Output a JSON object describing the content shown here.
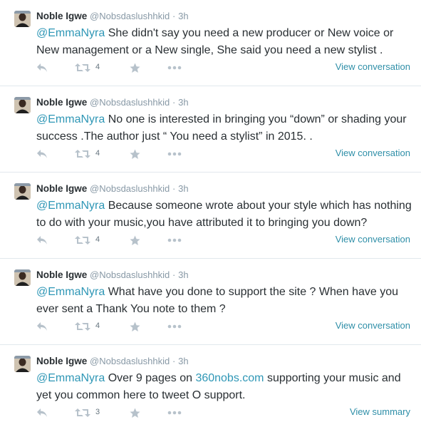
{
  "colors": {
    "mention": "#2f97b6",
    "muted": "#8899a6",
    "action_icon": "#b7c2cb",
    "divider": "#e1e8ed"
  },
  "tweets": [
    {
      "name": "Noble Igwe",
      "handle": "@Nobsdaslushhkid",
      "sep": "·",
      "time": "3h",
      "mention": "@EmmaNyra",
      "text": " She didn't say you need a new producer or New voice or New management or a New single, She said you need a new stylist .",
      "link": "",
      "text_after": "",
      "retweets": "4",
      "footer_link": "View conversation"
    },
    {
      "name": "Noble Igwe",
      "handle": "@Nobsdaslushhkid",
      "sep": "·",
      "time": "3h",
      "mention": "@EmmaNyra",
      "text": " No one is interested in bringing you “down” or shading your success .The author just “ You need a stylist” in 2015. .",
      "link": "",
      "text_after": "",
      "retweets": "4",
      "footer_link": "View conversation"
    },
    {
      "name": "Noble Igwe",
      "handle": "@Nobsdaslushhkid",
      "sep": "·",
      "time": "3h",
      "mention": "@EmmaNyra",
      "text": " Because someone wrote about your style which has nothing to do with your music,you have attributed it to bringing you down?",
      "link": "",
      "text_after": "",
      "retweets": "4",
      "footer_link": "View conversation"
    },
    {
      "name": "Noble Igwe",
      "handle": "@Nobsdaslushhkid",
      "sep": "·",
      "time": "3h",
      "mention": "@EmmaNyra",
      "text": " What have you done to support the site ? When have you ever sent a Thank You note to them ?",
      "link": "",
      "text_after": "",
      "retweets": "4",
      "footer_link": "View conversation"
    },
    {
      "name": "Noble Igwe",
      "handle": "@Nobsdaslushhkid",
      "sep": "·",
      "time": "3h",
      "mention": "@EmmaNyra",
      "text": " Over 9 pages on ",
      "link": "360nobs.com",
      "text_after": " supporting your music and yet you common here to tweet O support.",
      "retweets": "3",
      "footer_link": "View summary"
    }
  ]
}
